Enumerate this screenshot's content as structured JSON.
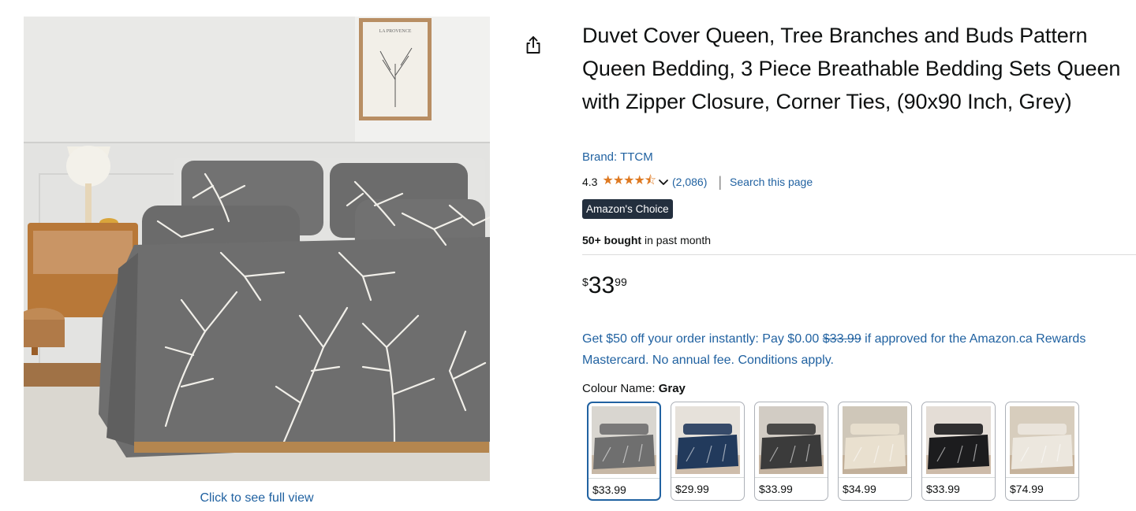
{
  "product": {
    "title": "Duvet Cover Queen, Tree Branches and Buds Pattern Queen Bedding, 3 Piece Breathable Bedding Sets Queen with Zipper Closure, Corner Ties, (90x90 Inch, Grey)",
    "brand": "Brand: TTCM",
    "rating": "4.3",
    "stars": "★★★★⯪",
    "reviews": "(2,086)",
    "search_link": "Search this page",
    "badge": "Amazon's Choice",
    "bought_strong": "50+ bought",
    "bought_rest": " in past month"
  },
  "image": {
    "full_view_link": "Click to see full view",
    "poster_text": "LA PROVENCE"
  },
  "price": {
    "currency": "$",
    "whole": "33",
    "fraction": "99"
  },
  "promo": {
    "text_1": "Get $50 off your order instantly: Pay $0.00 ",
    "struck": "$33.99",
    "text_2": " if approved for the Amazon.ca Rewards Mastercard. No annual fee. Conditions apply."
  },
  "colour": {
    "label": "Colour Name: ",
    "selected": "Gray",
    "options": [
      {
        "price": "$33.99",
        "color": "#6f6f6f",
        "bg": "#d9d6d0",
        "selected": true
      },
      {
        "price": "$29.99",
        "color": "#223a5c",
        "bg": "#e6e1da"
      },
      {
        "price": "$33.99",
        "color": "#3b3b3b",
        "bg": "#d2ccc4"
      },
      {
        "price": "$34.99",
        "color": "#e9e0cf",
        "bg": "#cfc7b9"
      },
      {
        "price": "$33.99",
        "color": "#1c1c1e",
        "bg": "#e4ddd6"
      },
      {
        "price": "$74.99",
        "color": "#ece7de",
        "bg": "#d7cdbd"
      }
    ]
  },
  "colors": {
    "link": "#2162a1",
    "star": "#de7921",
    "badge_bg": "#232f3e"
  }
}
